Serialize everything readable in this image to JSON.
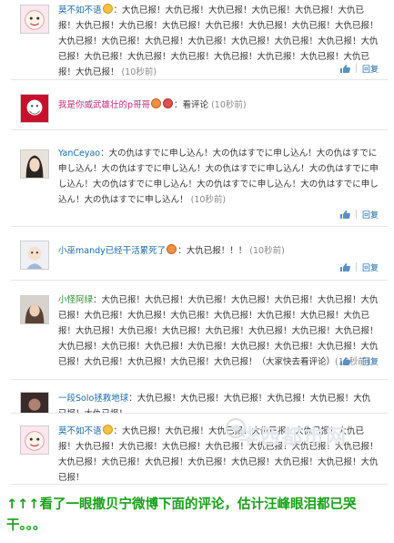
{
  "comments": [
    {
      "username": "莫不如不语",
      "text": "：大仇已报！大仇已报！大仇已报！大仇已报！大仇已报！大仇已报！大仇已报！大仇已报！大仇已报！大仇已报！大仇已报！大仇已报！大仇已报！大仇已报！大仇已报！大仇已报！大仇已报！大仇已报！大仇已报！大仇已报！大仇已报！大仇已报！大仇已报！大仇已报！大仇已报！大仇已报！大仇已报！大仇已报！大仇已报！",
      "time": "(10秒前)",
      "reply": "回复",
      "avatar": "cartoon-face-avatar"
    },
    {
      "username": "我是你威武雄壮的p哥哥",
      "text": "：看评论",
      "time": "(10秒前)",
      "reply": "",
      "avatar": "kfc-colonel-avatar"
    },
    {
      "username": "YanCeyao",
      "text": "：大の仇はすでに申し込ん！大の仇はすでに申し込ん！大の仇はすでに申し込ん！大の仇はすでに申し込ん！大の仇はすでに申し込ん！大の仇はすでに申し込ん！大の仇はすでに申し込ん！大の仇はすでに申し込ん！大の仇はすでに申し込ん！大の仇はすでに申し込ん！",
      "time": "(10秒前)",
      "reply": "回复",
      "avatar": "dark-hair-avatar"
    },
    {
      "username": "小巫mandy已经干活累死了",
      "text": "：大仇已报！！！",
      "time": "(10秒前)",
      "reply": "回复",
      "avatar": "doll-avatar"
    },
    {
      "username": "小怪阿绿",
      "text": "：大仇已报！大仇已报！大仇已报！大仇已报！大仇已报！大仇已报！大仇已报！大仇已报！大仇已报！大仇已报！大仇已报！大仇已报！大仇已报！大仇已报！大仇已报！大仇已报！大仇已报！大仇已报！大仇已报！大仇已报！大仇已报！大仇已报！大仇已报！大仇已报！大仇已报！大仇已报！大仇已报！大仇已报！大仇已报！大仇已报！大仇已报！大仇已报！大仇已报！（大家快去看评论）",
      "time": "(10秒前)",
      "reply": "回复",
      "avatar": "portrait-avatar"
    },
    {
      "username": "一段Solo拯救地球",
      "text": "：大仇已报！大仇已报！大仇已报！大仇已报！大仇已报！大仇已报！大仇已报！",
      "time": "",
      "reply": "",
      "avatar": "dark-avatar"
    },
    {
      "username": "莫不如不语",
      "text": "：大仇已报！大仇已报！大仇已报！大仇已报！大仇已报！大仇已报！大仇已报！大仇已报！大仇已报！大仇已报！大仇已报！大仇已报！大仇已报！大仇已报！大仇已报！大仇已报！大仇已报！大仇已报！大仇已报！大仇已报！大仇已报！",
      "time": "",
      "reply": "",
      "avatar": "cartoon-face-avatar"
    }
  ],
  "caption": "↑↑↑看了一眼撒贝宁微博下面的评论，估计汪峰眼泪都已哭干。。。",
  "watermark": "华西都市网",
  "colors": {
    "username_link": "#1a6aa8",
    "username_green": "#2e8c2e",
    "caption_green": "#1aa01a",
    "time_gray": "#888888"
  }
}
